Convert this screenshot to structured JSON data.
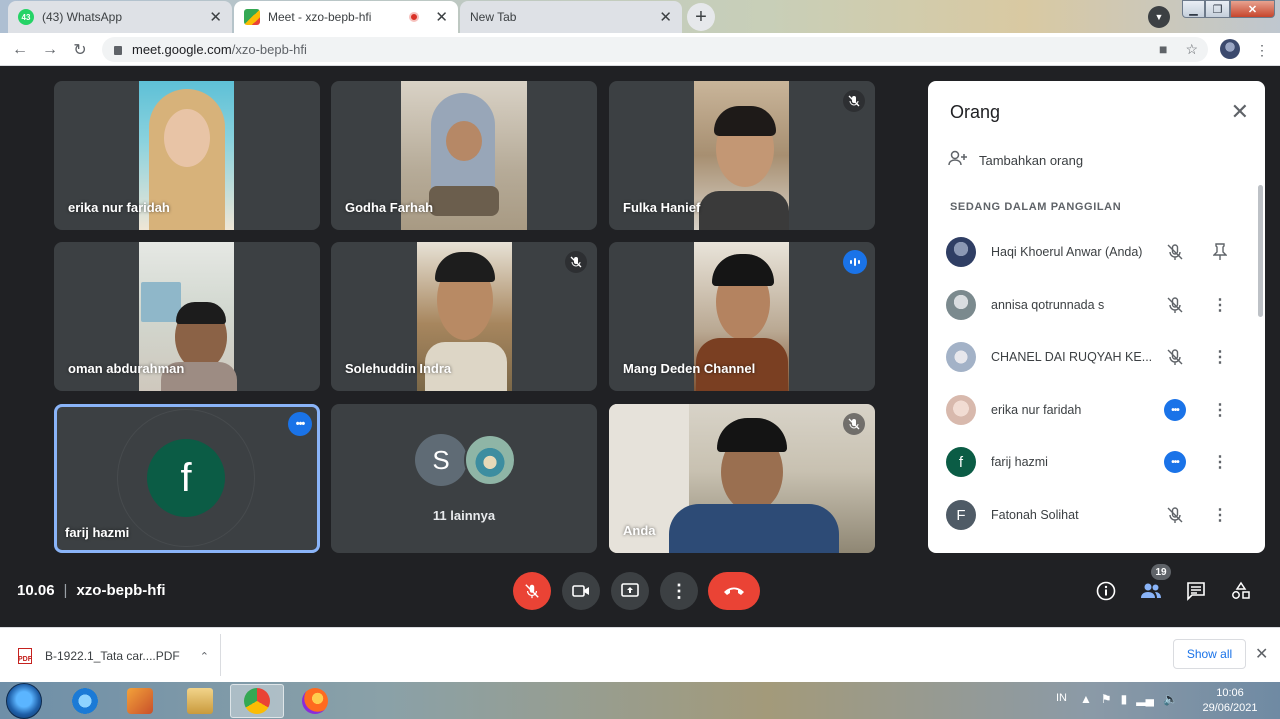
{
  "browser": {
    "tabs": [
      {
        "title": "(43) WhatsApp",
        "badge": "43"
      },
      {
        "title": "Meet - xzo-bepb-hfi",
        "active": true
      },
      {
        "title": "New Tab"
      }
    ],
    "url_host": "meet.google.com",
    "url_path": "/xzo-bepb-hfi"
  },
  "meet": {
    "tiles": [
      {
        "name": "erika nur faridah"
      },
      {
        "name": "Godha Farhah"
      },
      {
        "name": "Fulka Hanief"
      },
      {
        "name": "oman abdurahman"
      },
      {
        "name": "Solehuddin Indra"
      },
      {
        "name": "Mang Deden Channel"
      },
      {
        "name": "farij hazmi",
        "initial": "f"
      },
      {
        "name": "11 lainnya",
        "initial": "S"
      },
      {
        "name": "Anda"
      }
    ],
    "time": "10.06",
    "meeting_code": "xzo-bepb-hfi",
    "people_count": "19"
  },
  "panel": {
    "title": "Orang",
    "add_label": "Tambahkan orang",
    "section": "SEDANG DALAM PANGGILAN",
    "people": [
      {
        "name": "Haqi Khoerul Anwar (Anda)"
      },
      {
        "name": "annisa qotrunnada s"
      },
      {
        "name": "CHANEL DAI RUQYAH KE..."
      },
      {
        "name": "erika nur faridah"
      },
      {
        "name": "farij hazmi",
        "initial": "f"
      },
      {
        "name": "Fatonah Solihat",
        "initial": "F"
      }
    ]
  },
  "downloads": {
    "file": "B-1922.1_Tata car....PDF",
    "show_all": "Show all"
  },
  "taskbar": {
    "lang": "IN",
    "time": "10:06",
    "date": "29/06/2021"
  }
}
